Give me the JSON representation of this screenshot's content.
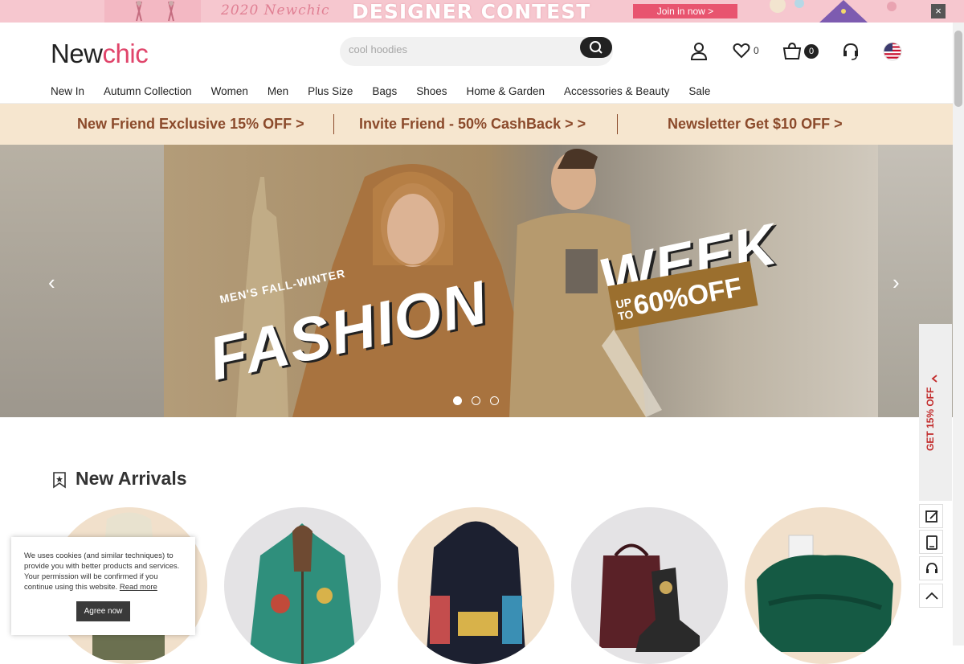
{
  "top_banner": {
    "year_script": "2020 Newchic",
    "contest_title": "DESIGNER CONTEST",
    "join_label": "Join in now >",
    "close_label": "×"
  },
  "header": {
    "logo_new": "New",
    "logo_chic": "chic",
    "search_placeholder": "cool hoodies",
    "wishlist_count": "0",
    "cart_count": "0"
  },
  "nav": {
    "items": [
      "New In",
      "Autumn Collection",
      "Women",
      "Men",
      "Plus Size",
      "Bags",
      "Shoes",
      "Home & Garden",
      "Accessories & Beauty",
      "Sale"
    ]
  },
  "promo_bar": {
    "items": [
      "New Friend Exclusive 15% OFF >",
      "Invite Friend - 50% CashBack > >",
      "Newsletter Get $10 OFF >"
    ],
    "color": "#8b4a2b",
    "background": "#f6e6cf"
  },
  "hero": {
    "subtitle": "MEN'S FALL-WINTER",
    "title_left": "FASHION",
    "title_right": "WEEK",
    "offer_up_to": "UP TO",
    "offer_value": "60%OFF",
    "slide_count": 3,
    "active_slide": 0
  },
  "side_tab": {
    "label": "GET 15% OFF"
  },
  "new_arrivals": {
    "title": "New Arrivals"
  },
  "cookie": {
    "text": "We uses cookies (and similar techniques) to provide you with better products and services. Your permission will be confirmed if you continue using this website.",
    "read_more": "Read more",
    "agree": "Agree now"
  },
  "colors": {
    "brand_pink": "#e0456b",
    "banner_pink": "#f6c7cf",
    "join_button": "#e8546f",
    "badge_dark": "#222222"
  }
}
